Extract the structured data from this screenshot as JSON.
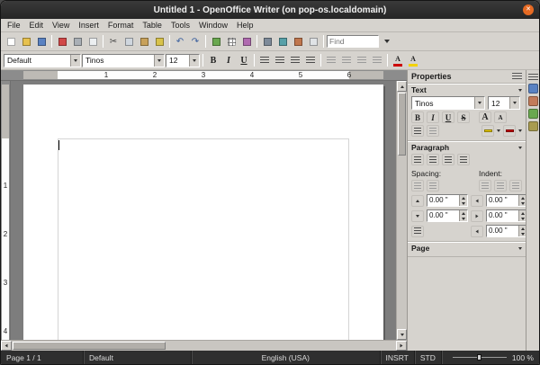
{
  "window": {
    "title": "Untitled 1 - OpenOffice Writer (on pop-os.localdomain)",
    "close_glyph": "✕"
  },
  "menubar": {
    "items": [
      "File",
      "Edit",
      "View",
      "Insert",
      "Format",
      "Table",
      "Tools",
      "Window",
      "Help"
    ]
  },
  "standard_toolbar": {
    "find_placeholder": "Find",
    "cut_glyph": "✂",
    "undo_glyph": "↶",
    "redo_glyph": "↷"
  },
  "formatting_toolbar": {
    "paragraph_style": "Default",
    "font_name": "Tinos",
    "font_size": "12",
    "bold": "B",
    "italic": "I",
    "underline": "U"
  },
  "horizontal_ruler": {
    "numbers": [
      "1",
      "2",
      "3",
      "4",
      "5",
      "6"
    ]
  },
  "vertical_ruler": {
    "numbers": [
      "1",
      "2",
      "3",
      "4"
    ]
  },
  "sidebar": {
    "title": "Properties",
    "text": {
      "title": "Text",
      "font_name": "Tinos",
      "font_size": "12",
      "bold": "B",
      "italic": "I",
      "underline": "U",
      "strikethrough": "S",
      "grow_font": "A",
      "shrink_font": "A",
      "highlight_letter": "A",
      "font_color_letter": "A"
    },
    "paragraph": {
      "title": "Paragraph",
      "spacing_label": "Spacing:",
      "indent_label": "Indent:",
      "spacing_above": "0.00 \"",
      "spacing_below": "0.00 \"",
      "indent_before": "0.00 \"",
      "indent_after": "0.00 \"",
      "indent_first_line": "0.00 \""
    },
    "page": {
      "title": "Page"
    }
  },
  "statusbar": {
    "page": "Page 1 / 1",
    "style": "Default",
    "language": "English (USA)",
    "insert_mode": "INSRT",
    "selection_mode": "STD",
    "zoom": "100 %"
  }
}
